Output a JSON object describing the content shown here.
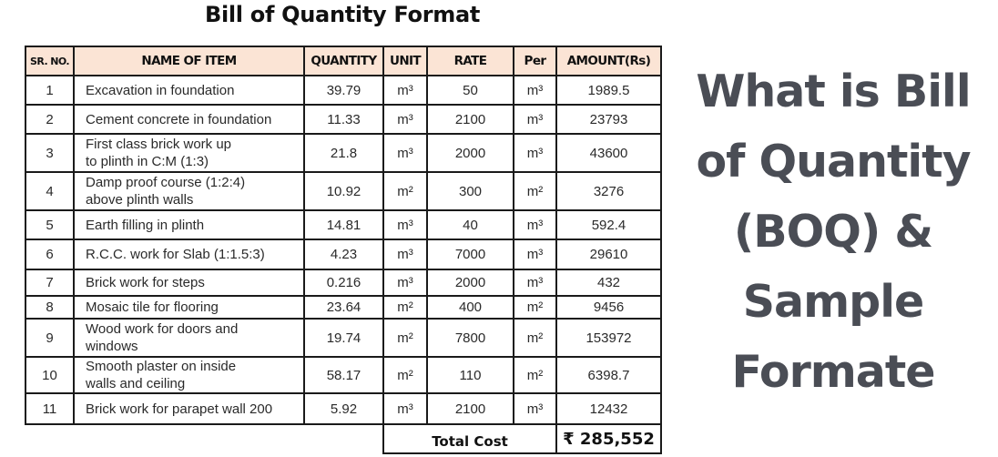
{
  "document": {
    "title": "Bill of Quantity Format",
    "side_heading_lines": [
      "What is Bill",
      "of Quantity",
      "(BOQ) &",
      "Sample",
      "Formate"
    ],
    "colors": {
      "header_fill": "#fbe4d5",
      "side_heading": "#4a4d55",
      "border": "#1a1a1a"
    }
  },
  "table": {
    "headers": [
      "SR. NO.",
      "NAME OF ITEM",
      "QUANTITY",
      "UNIT",
      "RATE",
      "Per",
      "AMOUNT(Rs)"
    ],
    "rows": [
      {
        "sr": "1",
        "name": [
          "Excavation in foundation"
        ],
        "quantity": "39.79",
        "unit": "m³",
        "rate": "50",
        "per": "m³",
        "amount": "1989.5"
      },
      {
        "sr": "2",
        "name": [
          "Cement concrete in foundation"
        ],
        "quantity": "11.33",
        "unit": "m³",
        "rate": "2100",
        "per": "m³",
        "amount": "23793"
      },
      {
        "sr": "3",
        "name": [
          "First class brick work up",
          "to plinth in C:M (1:3)"
        ],
        "quantity": "21.8",
        "unit": "m³",
        "rate": "2000",
        "per": "m³",
        "amount": "43600"
      },
      {
        "sr": "4",
        "name": [
          "Damp proof course (1:2:4)",
          "above plinth walls"
        ],
        "quantity": "10.92",
        "unit": "m²",
        "rate": "300",
        "per": "m²",
        "amount": "3276"
      },
      {
        "sr": "5",
        "name": [
          "Earth filling in plinth"
        ],
        "quantity": "14.81",
        "unit": "m³",
        "rate": "40",
        "per": "m³",
        "amount": "592.4"
      },
      {
        "sr": "6",
        "name": [
          "R.C.C. work for Slab (1:1.5:3)"
        ],
        "quantity": "4.23",
        "unit": "m³",
        "rate": "7000",
        "per": "m³",
        "amount": "29610"
      },
      {
        "sr": "7",
        "name": [
          "Brick work for steps"
        ],
        "quantity": "0.216",
        "unit": "m³",
        "rate": "2000",
        "per": "m³",
        "amount": "432"
      },
      {
        "sr": "8",
        "name": [
          "Mosaic tile for flooring"
        ],
        "quantity": "23.64",
        "unit": "m²",
        "rate": "400",
        "per": "m²",
        "amount": "9456"
      },
      {
        "sr": "9",
        "name": [
          "Wood work for doors and",
          "windows"
        ],
        "quantity": "19.74",
        "unit": "m²",
        "rate": "7800",
        "per": "m²",
        "amount": "153972"
      },
      {
        "sr": "10",
        "name": [
          "Smooth plaster on inside",
          " walls and ceiling"
        ],
        "quantity": "58.17",
        "unit": "m²",
        "rate": "110",
        "per": "m²",
        "amount": "6398.7"
      },
      {
        "sr": "11",
        "name": [
          "Brick work for parapet wall 200"
        ],
        "quantity": "5.92",
        "unit": "m³",
        "rate": "2100",
        "per": "m³",
        "amount": "12432"
      }
    ],
    "total": {
      "label": "Total Cost",
      "value": "₹ 285,552"
    }
  }
}
